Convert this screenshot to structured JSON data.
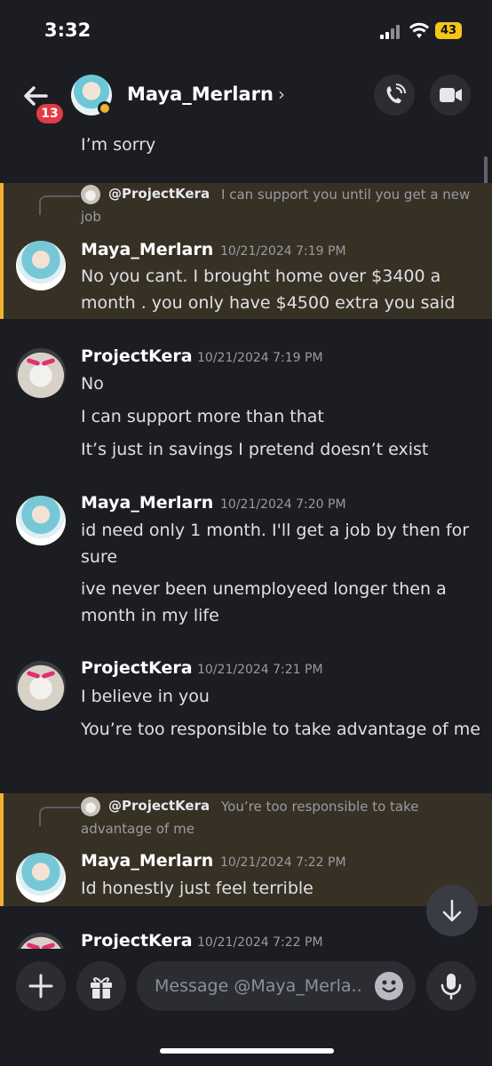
{
  "status_bar": {
    "time": "3:32",
    "battery": "43"
  },
  "header": {
    "unread_badge": "13",
    "name": "Maya_Merlarn",
    "chevron": "›"
  },
  "messages": {
    "m0": {
      "text": "I’m sorry"
    },
    "m1": {
      "reply_to": "@ProjectKera",
      "reply_text": "I can support you until you get a new job",
      "user": "Maya_Merlarn",
      "timestamp": "10/21/2024 7:19 PM",
      "text": "No you cant.  I brought home over $3400 a month .  you only have $4500 extra you said"
    },
    "m2": {
      "user": "ProjectKera",
      "timestamp": "10/21/2024 7:19 PM",
      "lines": [
        "No",
        "I can support more than that",
        "It’s just in savings I pretend doesn’t exist"
      ]
    },
    "m3": {
      "user": "Maya_Merlarn",
      "timestamp": "10/21/2024 7:20 PM",
      "lines": [
        "id need only 1 month.  I'll get a job by then for sure",
        "ive never been unemployeed longer then a month in my life"
      ]
    },
    "m4": {
      "user": "ProjectKera",
      "timestamp": "10/21/2024 7:21 PM",
      "lines": [
        "I believe in you",
        "You’re too responsible to take advantage of me"
      ]
    },
    "m5": {
      "reply_to": "@ProjectKera",
      "reply_text": "You’re too responsible to take advantage of me",
      "user": "Maya_Merlarn",
      "timestamp": "10/21/2024 7:22 PM",
      "text": "Id honestly just feel terrible"
    },
    "m6": {
      "user": "ProjectKera",
      "timestamp": "10/21/2024 7:22 PM"
    }
  },
  "composer": {
    "placeholder": "Message @Maya_Merla.."
  },
  "colors": {
    "background": "#1c1d22",
    "highlight": "#373125",
    "highlight_border": "#f0b232",
    "badge": "#e33b43"
  },
  "icons": [
    "back-arrow-icon",
    "phone-call-icon",
    "video-camera-icon",
    "plus-icon",
    "gift-icon",
    "emoji-icon",
    "microphone-icon",
    "arrow-down-icon"
  ]
}
